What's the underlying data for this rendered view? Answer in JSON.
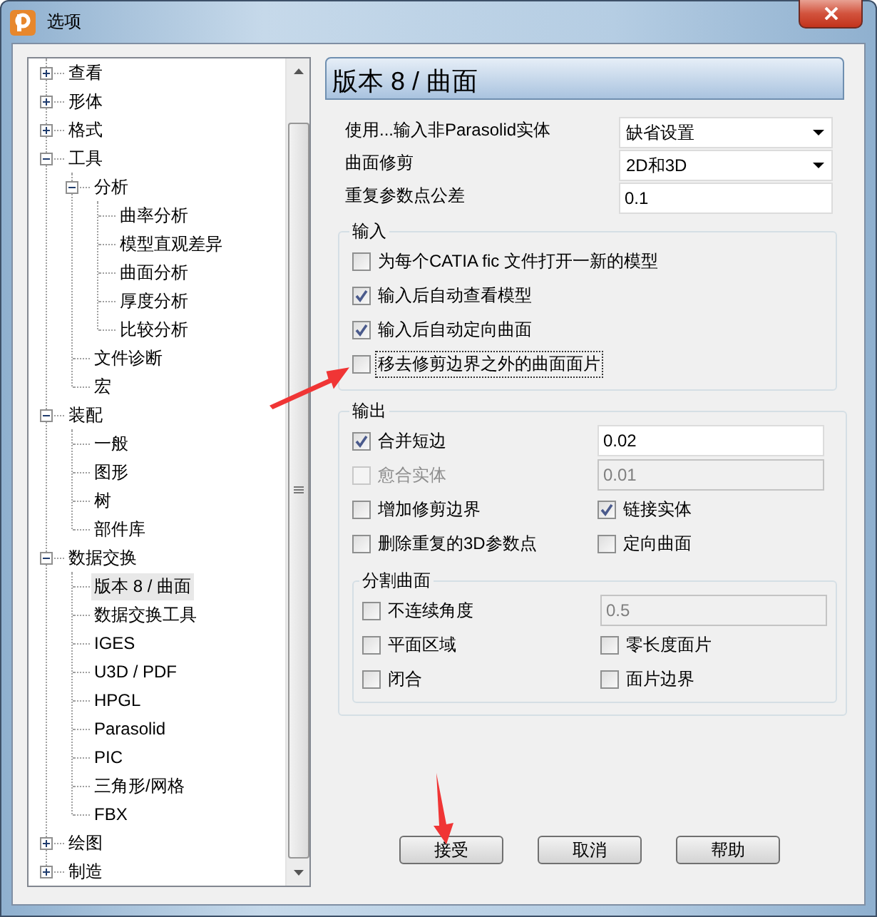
{
  "window": {
    "title": "选项"
  },
  "tree": [
    {
      "label": "查看",
      "expanded": false,
      "selected": false
    },
    {
      "label": "形体",
      "expanded": false,
      "selected": false
    },
    {
      "label": "格式",
      "expanded": false,
      "selected": false
    },
    {
      "label": "工具",
      "expanded": true,
      "selected": false,
      "children": [
        {
          "label": "分析",
          "expanded": true,
          "selected": false,
          "children": [
            {
              "label": "曲率分析",
              "selected": false
            },
            {
              "label": "模型直观差异",
              "selected": false
            },
            {
              "label": "曲面分析",
              "selected": false
            },
            {
              "label": "厚度分析",
              "selected": false
            },
            {
              "label": "比较分析",
              "selected": false
            }
          ]
        },
        {
          "label": "文件诊断",
          "selected": false
        },
        {
          "label": "宏",
          "selected": false
        }
      ]
    },
    {
      "label": "装配",
      "expanded": true,
      "selected": false,
      "children": [
        {
          "label": "一般",
          "selected": false
        },
        {
          "label": "图形",
          "selected": false
        },
        {
          "label": "树",
          "selected": false
        },
        {
          "label": "部件库",
          "selected": false
        }
      ]
    },
    {
      "label": "数据交换",
      "expanded": true,
      "selected": false,
      "children": [
        {
          "label": "版本 8 / 曲面",
          "selected": true
        },
        {
          "label": "数据交换工具",
          "selected": false
        },
        {
          "label": "IGES",
          "selected": false
        },
        {
          "label": "U3D / PDF",
          "selected": false
        },
        {
          "label": "HPGL",
          "selected": false
        },
        {
          "label": "Parasolid",
          "selected": false
        },
        {
          "label": "PIC",
          "selected": false
        },
        {
          "label": "三角形/网格",
          "selected": false
        },
        {
          "label": "FBX",
          "selected": false
        }
      ]
    },
    {
      "label": "绘图",
      "expanded": false,
      "selected": false
    },
    {
      "label": "制造",
      "expanded": false,
      "selected": false
    }
  ],
  "page": {
    "title": "版本 8 / 曲面",
    "settings": [
      {
        "label": "使用...输入非Parasolid实体",
        "kind": "dropdown",
        "value": "缺省设置"
      },
      {
        "label": "曲面修剪",
        "kind": "dropdown",
        "value": "2D和3D"
      },
      {
        "label": "重复参数点公差",
        "kind": "field",
        "value": "0.1"
      }
    ],
    "input_group": {
      "title": "输入",
      "options": [
        {
          "label": "为每个CATIA fic 文件打开一新的模型",
          "checked": false,
          "focused": false
        },
        {
          "label": "输入后自动查看模型",
          "checked": true,
          "focused": false
        },
        {
          "label": "输入后自动定向曲面",
          "checked": true,
          "focused": false
        },
        {
          "label": "移去修剪边界之外的曲面面片",
          "checked": false,
          "focused": true
        }
      ]
    },
    "output_group": {
      "title": "输出",
      "items": [
        {
          "kind": "checkbox",
          "label": "合并短边",
          "checked": true,
          "disabled": false
        },
        {
          "kind": "field",
          "value": "0.02",
          "disabled": false
        },
        {
          "kind": "checkbox",
          "label": "愈合实体",
          "checked": false,
          "disabled": true
        },
        {
          "kind": "field",
          "value": "0.01",
          "disabled": true
        },
        {
          "kind": "checkbox",
          "label": "增加修剪边界",
          "checked": false,
          "disabled": false
        },
        {
          "kind": "checkbox",
          "label": "链接实体",
          "checked": true,
          "disabled": false
        },
        {
          "kind": "checkbox",
          "label": "删除重复的3D参数点",
          "checked": false,
          "disabled": false
        },
        {
          "kind": "checkbox",
          "label": "定向曲面",
          "checked": false,
          "disabled": false
        }
      ],
      "split_group": {
        "title": "分割曲面",
        "items": [
          {
            "kind": "checkbox",
            "label": "不连续角度",
            "checked": false,
            "disabled": false
          },
          {
            "kind": "field",
            "value": "0.5",
            "disabled": true
          },
          {
            "kind": "checkbox",
            "label": "平面区域",
            "checked": false,
            "disabled": false
          },
          {
            "kind": "checkbox",
            "label": "零长度面片",
            "checked": false,
            "disabled": false
          },
          {
            "kind": "checkbox",
            "label": "闭合",
            "checked": false,
            "disabled": false
          },
          {
            "kind": "checkbox",
            "label": "面片边界",
            "checked": false,
            "disabled": false
          }
        ]
      }
    }
  },
  "buttons": [
    "接受",
    "取消",
    "帮助"
  ]
}
